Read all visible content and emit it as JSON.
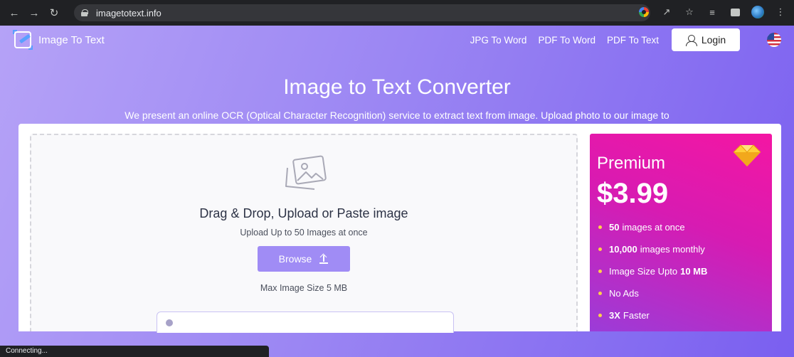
{
  "browser": {
    "url": "imagetotext.info"
  },
  "site": {
    "brand": "Image To Text",
    "nav": {
      "links": [
        "JPG To Word",
        "PDF To Word",
        "PDF To Text"
      ],
      "login_label": "Login"
    }
  },
  "hero": {
    "title": "Image to Text Converter",
    "description": "We present an online OCR (Optical Character Recognition) service to extract text from image. Upload photo to our image to text converter, click on submit and get your text file instantly."
  },
  "uploader": {
    "title": "Drag & Drop, Upload or Paste image",
    "subtitle": "Upload Up to 50 Images at once",
    "browse_label": "Browse",
    "max_size": "Max Image Size 5 MB"
  },
  "premium": {
    "title": "Premium",
    "price": "$3.99",
    "features": [
      {
        "bold": "50",
        "text": "images at once"
      },
      {
        "bold": "10,000",
        "text": "images monthly"
      },
      {
        "text": "Image Size Upto",
        "bold_after": "10 MB"
      },
      {
        "text": "No Ads"
      },
      {
        "bold": "3X",
        "text": "Faster"
      }
    ]
  },
  "status": {
    "text": "Connecting..."
  },
  "colors": {
    "accent": "#a08cf5",
    "premium_start": "#f416a3",
    "premium_end": "#9b3cd8",
    "bullet": "#ffd24a"
  }
}
